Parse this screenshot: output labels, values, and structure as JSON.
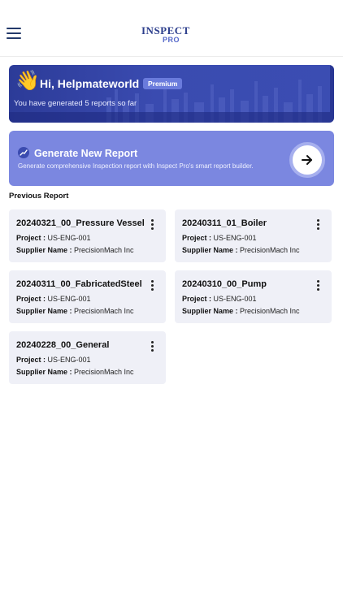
{
  "header": {
    "logo_top": "INSPECT",
    "logo_bottom": "PRO"
  },
  "welcome": {
    "greeting": "Hi, Helpmateworld !",
    "badge": "Premium",
    "subtitle": "You have generated 5 reports so far"
  },
  "generate": {
    "title": "Generate New Report",
    "description": "Generate comprehensive Inspection report with Inspect Pro's smart report builder."
  },
  "previous": {
    "title": "Previous Report",
    "project_label": "Project :",
    "supplier_label": "Supplier Name :",
    "reports": [
      {
        "name": "20240321_00_Pressure Vessel",
        "project": "US-ENG-001",
        "supplier": "PrecisionMach Inc"
      },
      {
        "name": "20240311_01_Boiler",
        "project": "US-ENG-001",
        "supplier": "PrecisionMach Inc"
      },
      {
        "name": "20240311_00_FabricatedSteel",
        "project": "US-ENG-001",
        "supplier": "PrecisionMach Inc"
      },
      {
        "name": "20240310_00_Pump",
        "project": "US-ENG-001",
        "supplier": "PrecisionMach Inc"
      },
      {
        "name": "20240228_00_General",
        "project": "US-ENG-001",
        "supplier": "PrecisionMach Inc"
      }
    ]
  },
  "colors": {
    "brand_dark": "#2c3b98",
    "brand_light": "#7b87e0",
    "card_bg": "#eff0f7"
  },
  "icons": {
    "menu": "hamburger-menu-icon",
    "wave": "waving-hand-icon",
    "generate": "trend-chart-icon",
    "arrow": "arrow-right-icon",
    "kebab": "more-vertical-icon"
  }
}
